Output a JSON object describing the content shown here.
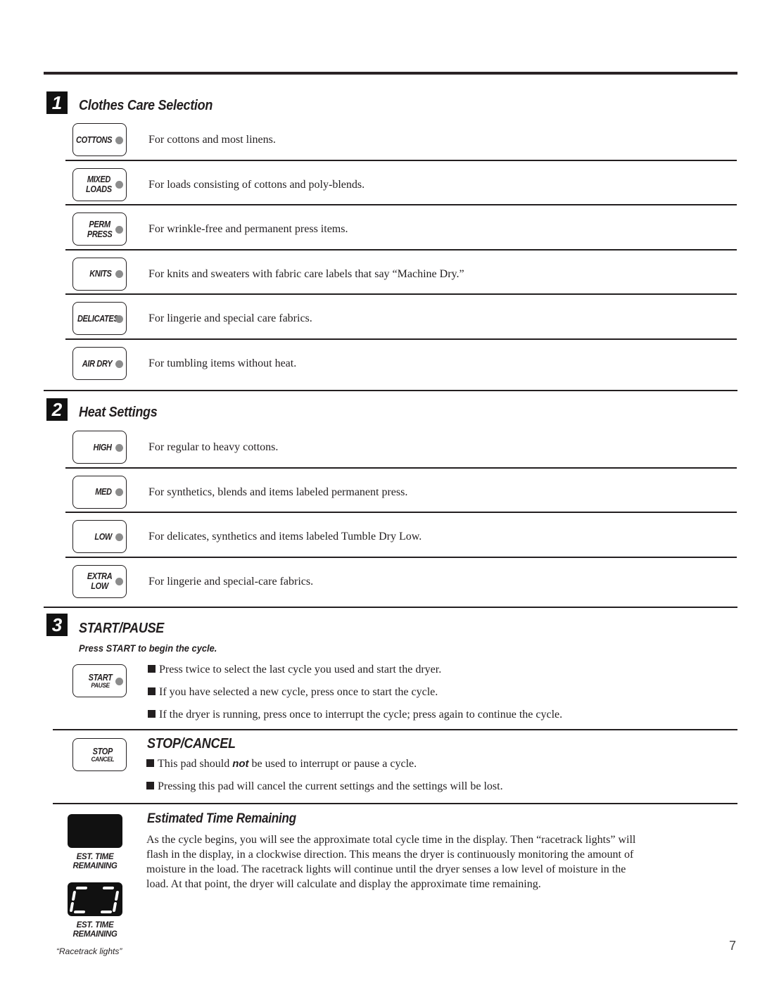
{
  "page_number": "7",
  "sections": {
    "clothes_care": {
      "number": "1",
      "title": "Clothes Care Selection",
      "items": [
        {
          "pad": [
            "COTTONS"
          ],
          "description": "For cottons and most linens."
        },
        {
          "pad": [
            "MIXED",
            "LOADS"
          ],
          "description": "For loads consisting of cottons and poly-blends."
        },
        {
          "pad": [
            "PERM",
            "PRESS"
          ],
          "description": "For wrinkle-free and permanent press items."
        },
        {
          "pad": [
            "KNITS"
          ],
          "description": "For knits and sweaters with fabric care labels that say “Machine Dry.”"
        },
        {
          "pad": [
            "DELICATES"
          ],
          "description": "For lingerie and special care fabrics."
        },
        {
          "pad": [
            "AIR DRY"
          ],
          "description": "For tumbling items without heat."
        }
      ]
    },
    "heat_settings": {
      "number": "2",
      "title": "Heat Settings",
      "items": [
        {
          "pad": [
            "HIGH"
          ],
          "description": "For regular to heavy cottons."
        },
        {
          "pad": [
            "MED"
          ],
          "description": "For synthetics, blends and items labeled permanent press."
        },
        {
          "pad": [
            "LOW"
          ],
          "description": "For delicates, synthetics and items labeled Tumble Dry Low."
        },
        {
          "pad": [
            "EXTRA",
            "LOW"
          ],
          "description": "For lingerie and special-care fabrics."
        }
      ]
    },
    "start_pause": {
      "number": "3",
      "title": "START/PAUSE",
      "subtitle": "Press START to begin the cycle.",
      "pad": [
        "START",
        "PAUSE"
      ],
      "bullets": [
        "Press twice to select the last cycle you used and start the dryer.",
        "If you have selected a new cycle, press once to start the cycle.",
        "If the dryer is running, press once to interrupt the cycle; press again to continue the cycle."
      ]
    },
    "stop_cancel": {
      "title": "STOP/CANCEL",
      "pad": [
        "STOP",
        "CANCEL"
      ],
      "bullet1_before": "This pad should ",
      "bullet1_emph": "not",
      "bullet1_after": " be used to interrupt or pause a cycle.",
      "bullet2": "Pressing this pad will cancel the current settings and the settings will be lost."
    },
    "est_time": {
      "title": "Estimated Time Remaining",
      "paragraph_lines": [
        "As the cycle begins, you will see the approximate total cycle time in the display. Then “racetrack lights” will",
        "flash in the display, in a clockwise direction. This means the dryer is continuously monitoring the amount of",
        "moisture in the load. The racetrack lights will continue until the dryer senses a low level of moisture in the",
        "load. At that point, the dryer will calculate and display the approximate time remaining."
      ],
      "display_label": [
        "EST. TIME",
        "REMAINING"
      ],
      "caption": "“Racetrack lights”"
    }
  }
}
